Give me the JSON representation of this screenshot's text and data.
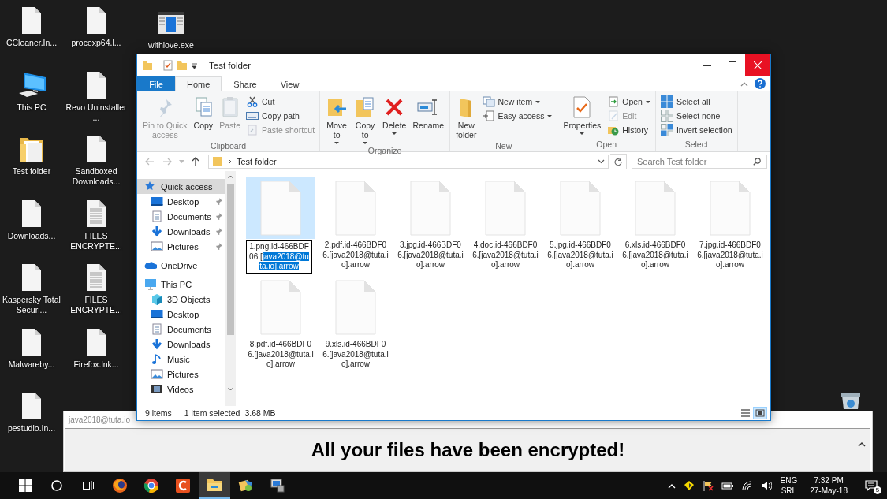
{
  "desktop_icons": [
    {
      "label": "CCleaner.In...",
      "kind": "file"
    },
    {
      "label": "This PC",
      "kind": "pc"
    },
    {
      "label": "Test folder",
      "kind": "folder"
    },
    {
      "label": "Downloads...",
      "kind": "file"
    },
    {
      "label": "Kaspersky Total Securi...",
      "kind": "file"
    },
    {
      "label": "Malwareby...",
      "kind": "file"
    },
    {
      "label": "pestudio.In...",
      "kind": "file"
    },
    {
      "label": "procexp64.l...",
      "kind": "file"
    },
    {
      "label": "Revo Uninstaller ...",
      "kind": "file"
    },
    {
      "label": "Sandboxed Downloads...",
      "kind": "file"
    },
    {
      "label": "FILES ENCRYPTE...",
      "kind": "text"
    },
    {
      "label": "FILES ENCRYPTE...",
      "kind": "text"
    },
    {
      "label": "Firefox.lnk...",
      "kind": "file"
    },
    {
      "label": "withlove.exe",
      "kind": "exe"
    }
  ],
  "ransom_window": {
    "title": "java2018@tuta.io",
    "heading": "All your files have been encrypted!"
  },
  "explorer": {
    "title": "Test folder",
    "tabs": [
      {
        "label": "File",
        "kind": "file",
        "selected": false
      },
      {
        "label": "Home",
        "kind": "tab",
        "selected": true
      },
      {
        "label": "Share",
        "kind": "tab",
        "selected": false
      },
      {
        "label": "View",
        "kind": "tab",
        "selected": false
      }
    ],
    "ribbon_groups": [
      {
        "label": "Clipboard",
        "buttons": [
          {
            "label": "Pin to Quick\naccess",
            "kind": "large",
            "dropdown": false,
            "disabled": true
          },
          {
            "label": "Copy",
            "kind": "large",
            "dropdown": false,
            "disabled": false
          },
          {
            "label": "Paste",
            "kind": "large",
            "dropdown": false,
            "disabled": true
          },
          {
            "label": "Cut",
            "kind": "small",
            "dropdown": false,
            "disabled": false
          },
          {
            "label": "Copy path",
            "kind": "small",
            "dropdown": false,
            "disabled": false
          },
          {
            "label": "Paste shortcut",
            "kind": "small",
            "dropdown": false,
            "disabled": true
          }
        ]
      },
      {
        "label": "Organize",
        "buttons": [
          {
            "label": "Move\nto",
            "kind": "large",
            "dropdown": true,
            "disabled": false
          },
          {
            "label": "Copy\nto",
            "kind": "large",
            "dropdown": true,
            "disabled": false
          },
          {
            "label": "Delete",
            "kind": "large",
            "dropdown": true,
            "disabled": false
          },
          {
            "label": "Rename",
            "kind": "large",
            "dropdown": false,
            "disabled": false
          }
        ]
      },
      {
        "label": "New",
        "buttons": [
          {
            "label": "New\nfolder",
            "kind": "large",
            "dropdown": false,
            "disabled": false
          },
          {
            "label": "New item",
            "kind": "small",
            "dropdown": true,
            "disabled": false
          },
          {
            "label": "Easy access",
            "kind": "small",
            "dropdown": true,
            "disabled": false
          }
        ]
      },
      {
        "label": "Open",
        "buttons": [
          {
            "label": "Properties",
            "kind": "large",
            "dropdown": true,
            "disabled": false
          },
          {
            "label": "Open",
            "kind": "small",
            "dropdown": true,
            "disabled": false
          },
          {
            "label": "Edit",
            "kind": "small",
            "dropdown": false,
            "disabled": true
          },
          {
            "label": "History",
            "kind": "small",
            "dropdown": false,
            "disabled": false
          }
        ]
      },
      {
        "label": "Select",
        "buttons": [
          {
            "label": "Select all",
            "kind": "small",
            "dropdown": false,
            "disabled": false
          },
          {
            "label": "Select none",
            "kind": "small",
            "dropdown": false,
            "disabled": false
          },
          {
            "label": "Invert selection",
            "kind": "small",
            "dropdown": false,
            "disabled": false
          }
        ]
      }
    ],
    "path": "Test folder",
    "search": {
      "placeholder": "Search Test folder"
    },
    "nav": [
      {
        "label": "Quick access",
        "kind": "star",
        "selected": true,
        "children": [
          {
            "label": "Desktop",
            "kind": "desktop",
            "pinned": true,
            "selected": false
          },
          {
            "label": "Documents",
            "kind": "documents",
            "pinned": true,
            "selected": false
          },
          {
            "label": "Downloads",
            "kind": "downloads",
            "pinned": true,
            "selected": false
          },
          {
            "label": "Pictures",
            "kind": "pictures",
            "pinned": true,
            "selected": false
          }
        ]
      },
      {
        "label": "OneDrive",
        "kind": "cloud",
        "selected": false
      },
      {
        "label": "This PC",
        "kind": "pc",
        "selected": false,
        "children": [
          {
            "label": "3D Objects",
            "kind": "cube",
            "pinned": false,
            "selected": false
          },
          {
            "label": "Desktop",
            "kind": "desktop",
            "pinned": false,
            "selected": false
          },
          {
            "label": "Documents",
            "kind": "documents",
            "pinned": false,
            "selected": false
          },
          {
            "label": "Downloads",
            "kind": "downloads",
            "pinned": false,
            "selected": false
          },
          {
            "label": "Music",
            "kind": "music",
            "pinned": false,
            "selected": false
          },
          {
            "label": "Pictures",
            "kind": "pictures",
            "pinned": false,
            "selected": false
          },
          {
            "label": "Videos",
            "kind": "videos",
            "pinned": false,
            "selected": false
          }
        ]
      }
    ],
    "files": [
      {
        "name": "1.png.id-466BDF06.[",
        "selected_text": "java2018@tuta.io].arrow",
        "selected": true,
        "editing": true
      },
      {
        "name": "2.pdf.id-466BDF06.[java2018@tuta.io].arrow",
        "selected": false,
        "editing": false
      },
      {
        "name": "3.jpg.id-466BDF06.[java2018@tuta.io].arrow",
        "selected": false,
        "editing": false
      },
      {
        "name": "4.doc.id-466BDF06.[java2018@tuta.io].arrow",
        "selected": false,
        "editing": false
      },
      {
        "name": "5.jpg.id-466BDF06.[java2018@tuta.io].arrow",
        "selected": false,
        "editing": false
      },
      {
        "name": "6.xls.id-466BDF06.[java2018@tuta.io].arrow",
        "selected": false,
        "editing": false
      },
      {
        "name": "7.jpg.id-466BDF06.[java2018@tuta.io].arrow",
        "selected": false,
        "editing": false
      },
      {
        "name": "8.pdf.id-466BDF06.[java2018@tuta.io].arrow",
        "selected": false,
        "editing": false
      },
      {
        "name": "9.xls.id-466BDF06.[java2018@tuta.io].arrow",
        "selected": false,
        "editing": false
      }
    ],
    "status": {
      "count": "9 items",
      "selection": "1 item selected",
      "size": "3.68 MB"
    },
    "views": [
      {
        "kind": "details",
        "selected": false
      },
      {
        "kind": "large",
        "selected": true
      }
    ]
  },
  "taskbar": {
    "apps": [
      {
        "kind": "firefox",
        "active": false
      },
      {
        "kind": "chrome",
        "active": false
      },
      {
        "kind": "cleaner",
        "active": false
      },
      {
        "kind": "explorer",
        "active": true
      },
      {
        "kind": "tool",
        "active": false
      },
      {
        "kind": "monitor",
        "active": false
      }
    ],
    "language": "ENG",
    "layout": "SRL",
    "time": "7:32 PM",
    "date": "27-May-18",
    "notifications": "5"
  }
}
